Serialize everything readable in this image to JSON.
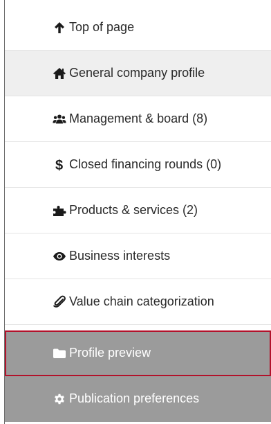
{
  "nav": {
    "items": [
      {
        "label": "Top of page",
        "icon": "arrow-up-icon",
        "state": "default"
      },
      {
        "label": "General company profile",
        "icon": "home-icon",
        "state": "shaded"
      },
      {
        "label": "Management & board (8)",
        "icon": "users-icon",
        "state": "default"
      },
      {
        "label": "Closed financing rounds (0)",
        "icon": "dollar-icon",
        "state": "default"
      },
      {
        "label": "Products & services (2)",
        "icon": "puzzle-icon",
        "state": "default"
      },
      {
        "label": "Business interests",
        "icon": "eye-icon",
        "state": "default"
      },
      {
        "label": "Value chain categorization",
        "icon": "paperclip-icon",
        "state": "default"
      },
      {
        "label": "Profile preview",
        "icon": "folder-icon",
        "state": "dark-selected"
      },
      {
        "label": "Publication preferences",
        "icon": "gear-icon",
        "state": "dark"
      }
    ]
  },
  "colors": {
    "selected_outline": "#b2122b",
    "dark_row": "#9b9b9b",
    "shaded_row": "#efefef"
  }
}
